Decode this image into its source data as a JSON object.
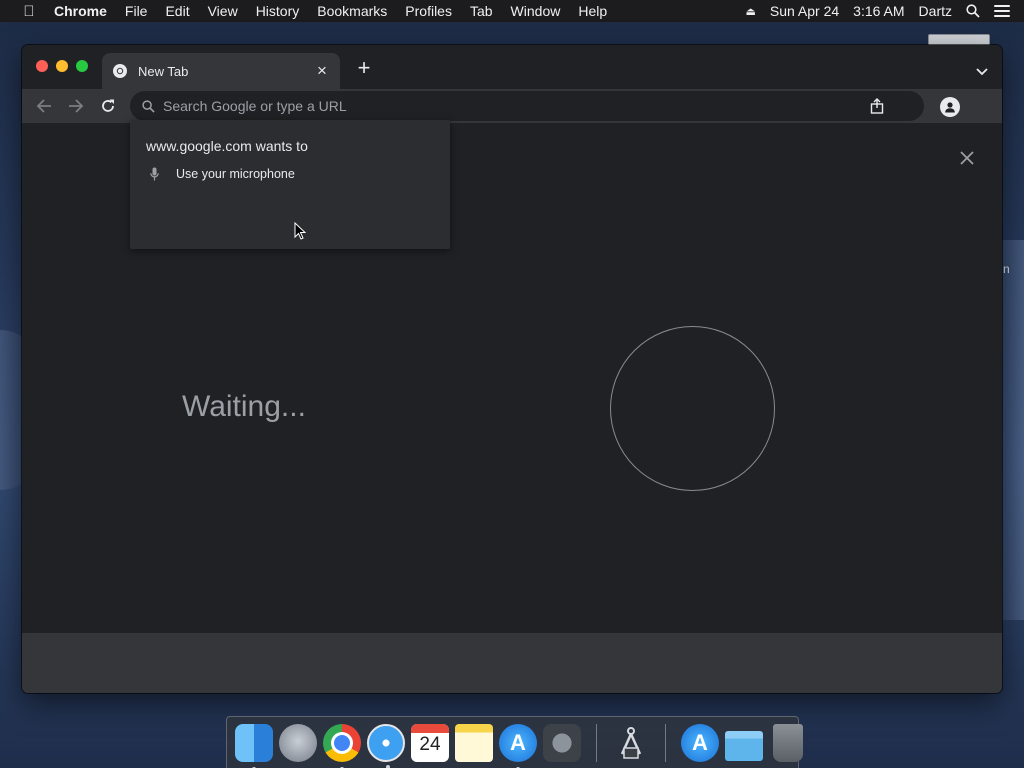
{
  "menubar": {
    "apple_icon": "apple-logo-icon",
    "app_name": "Chrome",
    "items": [
      "File",
      "Edit",
      "View",
      "History",
      "Bookmarks",
      "Profiles",
      "Tab",
      "Window",
      "Help"
    ],
    "date": "Sun Apr 24",
    "time": "3:16 AM",
    "user": "Dartz",
    "status_icons": [
      "eject-icon",
      "spotlight-search-icon",
      "notification-center-icon"
    ]
  },
  "browser": {
    "tab": {
      "title": "New Tab",
      "favicon": "chrome-favicon-icon"
    },
    "omnibox": {
      "placeholder": "Search Google or type a URL"
    },
    "icons": [
      "back-arrow-icon",
      "forward-arrow-icon",
      "reload-icon",
      "share-icon",
      "profile-icon",
      "tab-search-chevron-icon"
    ]
  },
  "permission_popup": {
    "title": "www.google.com wants to",
    "permission": "Use your microphone",
    "permission_icon": "microphone-icon"
  },
  "voice_search": {
    "status": "Waiting..."
  },
  "desktop": {
    "edge_label": "n"
  },
  "dock": {
    "items": [
      {
        "name": "finder",
        "running": true
      },
      {
        "name": "launchpad",
        "running": false
      },
      {
        "name": "chrome",
        "running": true
      },
      {
        "name": "safari",
        "running": true
      },
      {
        "name": "calendar",
        "running": false,
        "day": "24"
      },
      {
        "name": "notes",
        "running": false
      },
      {
        "name": "app-store",
        "running": true
      },
      {
        "name": "system-preferences",
        "running": false
      },
      {
        "name": "screenshot",
        "running": false
      },
      {
        "name": "app-store-folder",
        "running": false
      },
      {
        "name": "downloads-folder",
        "running": false
      },
      {
        "name": "trash",
        "running": false
      }
    ]
  },
  "colors": {
    "window_bg": "#202124",
    "toolbar_bg": "#35363a",
    "text_light": "#e8eaed",
    "text_muted": "#9aa0a6"
  }
}
